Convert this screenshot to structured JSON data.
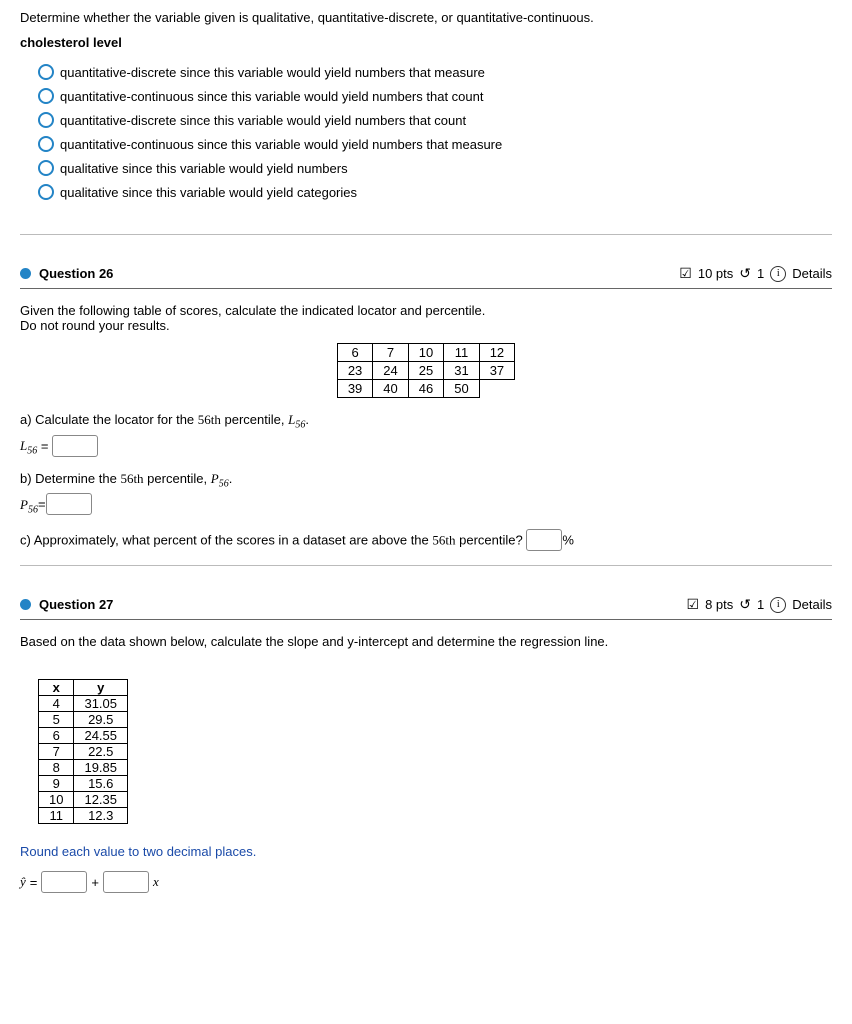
{
  "q25": {
    "prompt": "Determine whether the variable given is qualitative, quantitative-discrete, or quantitative-continuous.",
    "variable": "cholesterol level",
    "options": [
      "quantitative-discrete since this variable would yield numbers that measure",
      "quantitative-continuous since this variable would yield numbers that count",
      "quantitative-discrete since this variable would yield numbers that count",
      "quantitative-continuous since this variable would yield numbers that measure",
      "qualitative since this variable would yield numbers",
      "qualitative since this variable would yield categories"
    ]
  },
  "q26": {
    "title": "Question 26",
    "points": "10 pts",
    "attempts": "1",
    "details": "Details",
    "intro1": "Given the following table of scores, calculate the indicated locator and percentile.",
    "intro2": "Do not round your results.",
    "table": [
      [
        "6",
        "7",
        "10",
        "11",
        "12"
      ],
      [
        "23",
        "24",
        "25",
        "31",
        "37"
      ],
      [
        "39",
        "40",
        "46",
        "50",
        ""
      ]
    ],
    "partA_text_pre": "a) Calculate the locator for the ",
    "ordinal": "56th",
    "partA_text_post": " percentile, ",
    "L56_label": "L",
    "L56_sub": "56",
    "equals": " = ",
    "partB_text_pre": "b) Determine the ",
    "partB_text_post": " percentile, ",
    "P56_label": "P",
    "P56_sub": "56",
    "partC_pre": "c) Approximately, what percent of the scores in a dataset are above the ",
    "partC_post": " percentile?",
    "percent": "%"
  },
  "q27": {
    "title": "Question 27",
    "points": "8 pts",
    "attempts": "1",
    "details": "Details",
    "intro": "Based on the data shown below, calculate the slope and y-intercept and determine the regression line.",
    "headers": [
      "x",
      "y"
    ],
    "rows": [
      [
        "4",
        "31.05"
      ],
      [
        "5",
        "29.5"
      ],
      [
        "6",
        "24.55"
      ],
      [
        "7",
        "22.5"
      ],
      [
        "8",
        "19.85"
      ],
      [
        "9",
        "15.6"
      ],
      [
        "10",
        "12.35"
      ],
      [
        "11",
        "12.3"
      ]
    ],
    "note": "Round each value to two decimal places.",
    "yhat": "ŷ",
    "equals": " = ",
    "plus": "+",
    "xvar": "x"
  }
}
